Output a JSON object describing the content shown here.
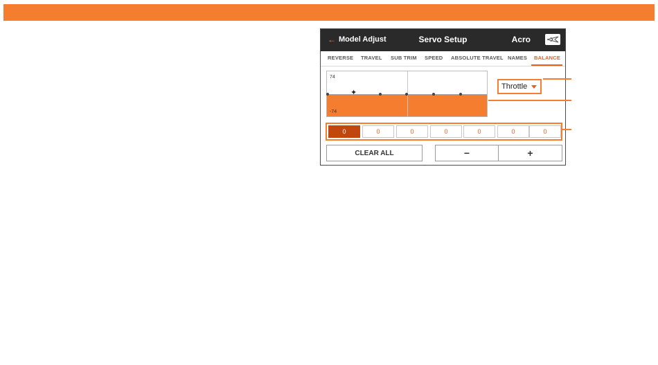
{
  "header": {
    "back_label": "Model Adjust",
    "title": "Servo Setup",
    "model_name": "Acro",
    "model_icon": "airplane-icon"
  },
  "tabs": [
    {
      "label": "REVERSE",
      "active": false
    },
    {
      "label": "TRAVEL",
      "active": false
    },
    {
      "label": "SUB TRIM",
      "active": false
    },
    {
      "label": "SPEED",
      "active": false
    },
    {
      "label": "ABSOLUTE TRAVEL",
      "active": false
    },
    {
      "label": "NAMES",
      "active": false
    },
    {
      "label": "BALANCE",
      "active": true
    }
  ],
  "graph": {
    "top_label": "74",
    "bottom_label": "-74",
    "points": 7,
    "selected_point": 1
  },
  "channel_select": {
    "value": "Throttle"
  },
  "balance_values": [
    "0",
    "0",
    "0",
    "0",
    "0",
    "0",
    "0"
  ],
  "active_cell": 0,
  "buttons": {
    "clear_all": "CLEAR ALL",
    "minus": "−",
    "plus": "+"
  },
  "colors": {
    "accent": "#f47d30",
    "active_cell": "#c2470f",
    "titlebar": "#2a2a2a"
  }
}
